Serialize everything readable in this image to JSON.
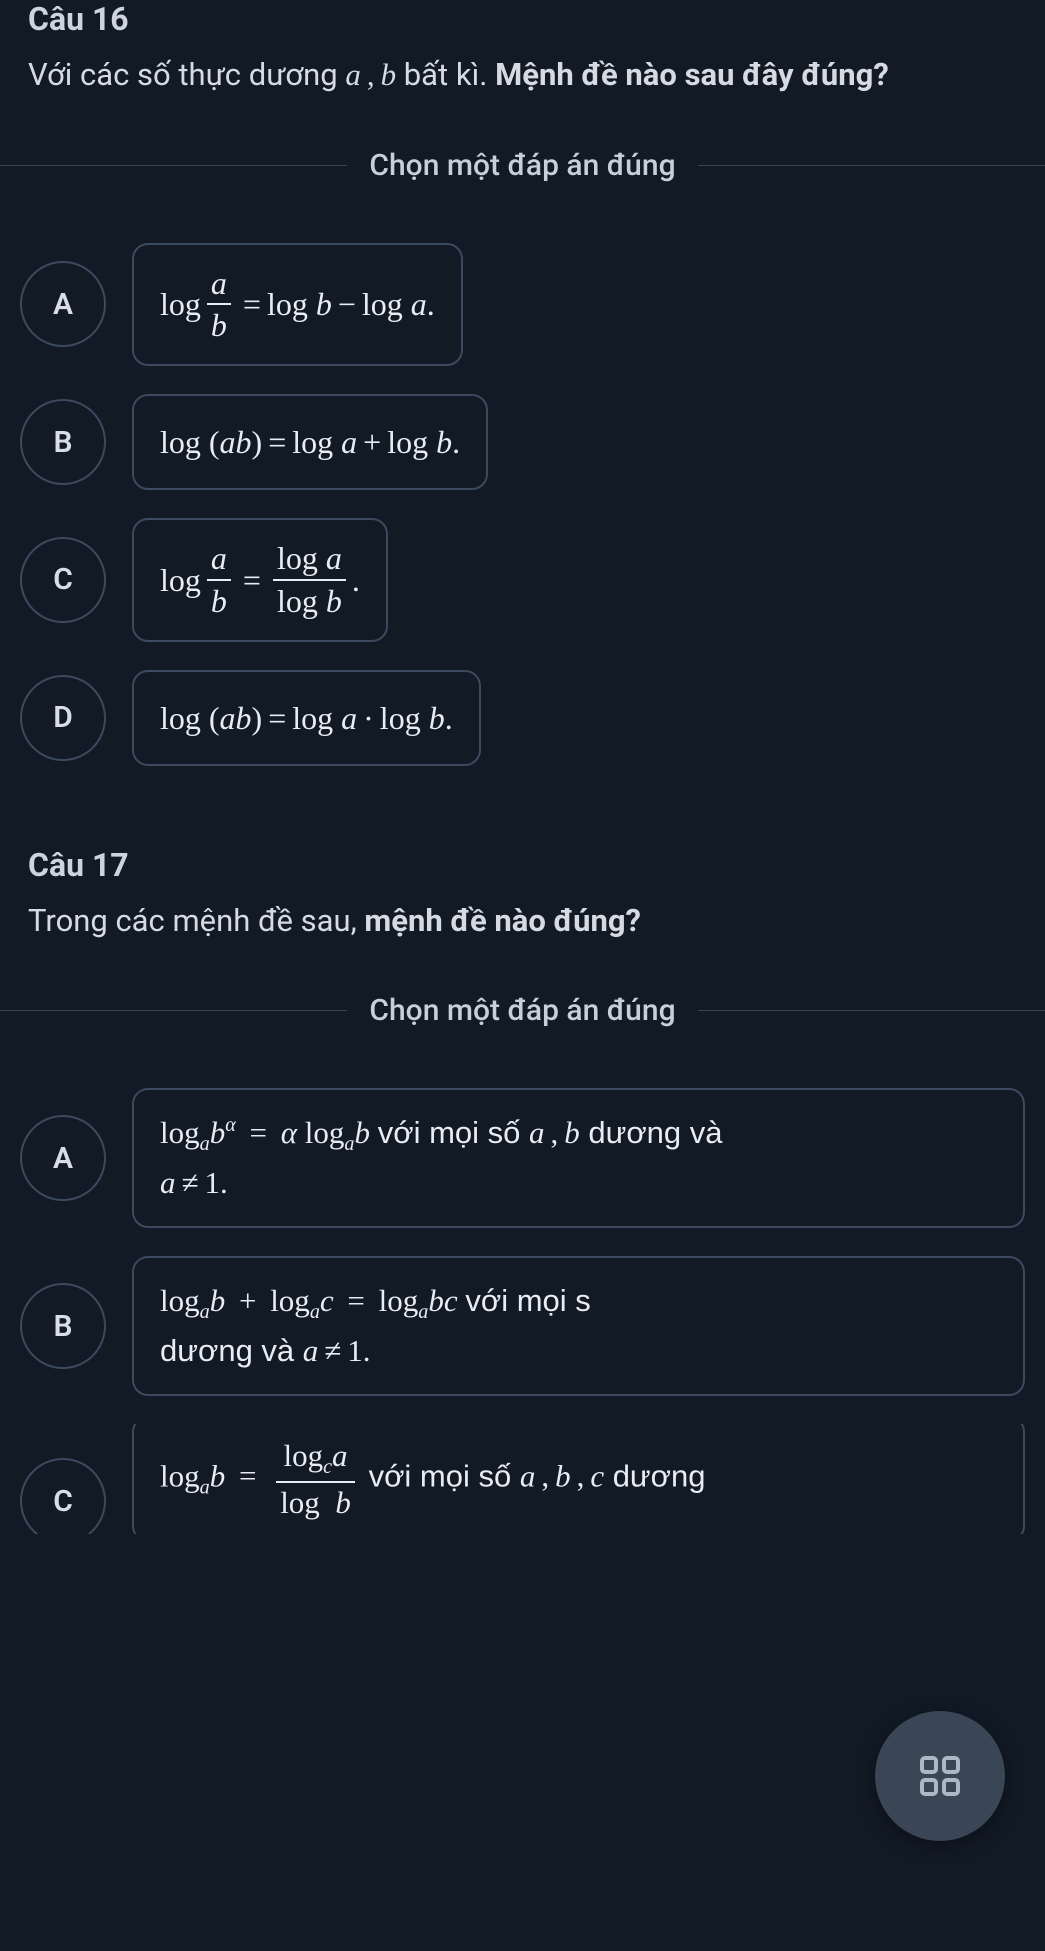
{
  "questions": [
    {
      "number": "Câu 16",
      "prompt_prefix": "Với các số thực dương ",
      "prompt_vars": "a , b",
      "prompt_mid": " bất kì. ",
      "prompt_bold": "Mệnh đề nào sau đây đúng?",
      "instruction": "Chọn một đáp án đúng",
      "options": [
        {
          "letter": "A",
          "formula": "log (a/b) = log b − log a."
        },
        {
          "letter": "B",
          "formula": "log (ab) = log a + log b."
        },
        {
          "letter": "C",
          "formula": "log (a/b) = (log a)/(log b)."
        },
        {
          "letter": "D",
          "formula": "log (ab) = log a · log b."
        }
      ]
    },
    {
      "number": "Câu 17",
      "prompt_prefix": "Trong các mệnh đề sau, ",
      "prompt_bold": "mệnh đề nào đúng?",
      "instruction": "Chọn một đáp án đúng",
      "options": [
        {
          "letter": "A",
          "formula": "log_a b^α = α log_a b với mọi số a , b dương và a ≠ 1."
        },
        {
          "letter": "B",
          "formula": "log_a b + log_a c = log_a bc với mọi s… dương và a ≠ 1."
        },
        {
          "letter": "C",
          "formula": "log_a b = (log_c a)/(log_c b) với mọi số a , b , c dương"
        }
      ]
    }
  ],
  "fab": {
    "icon": "grid-icon"
  }
}
